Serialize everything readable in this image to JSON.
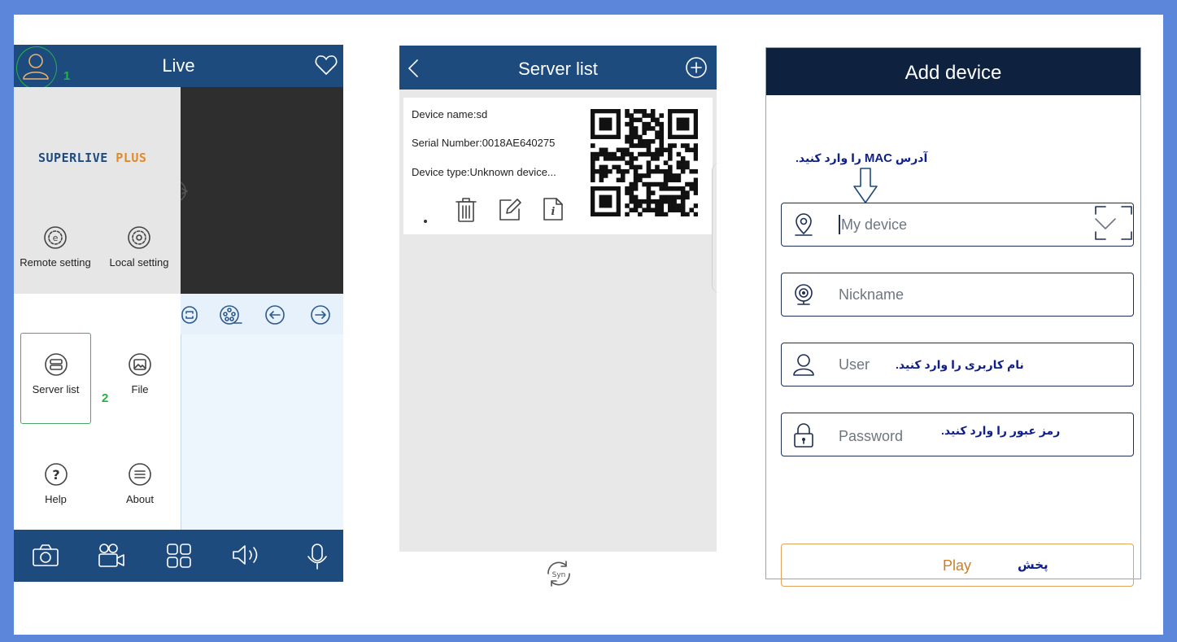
{
  "colors": {
    "frame": "#5b86d9",
    "app_blue": "#1d4b7e",
    "dark_navy": "#0e2240",
    "annotation_green": "#23b33f",
    "annotation_blue": "#0f1f8a",
    "play_orange": "#e3a35a"
  },
  "phone1": {
    "header": {
      "title": "Live",
      "avatar_icon": "user-icon",
      "favorite_icon": "heart-icon"
    },
    "annotations": {
      "step1": "1",
      "step2": "2"
    },
    "logo": {
      "part1": "SUPERLIVE",
      "part2": " PLUS"
    },
    "menu": [
      {
        "label": "Remote setting",
        "icon": "remote-setting-icon"
      },
      {
        "label": "Local setting",
        "icon": "local-setting-icon"
      },
      {
        "label": "Server list",
        "icon": "server-list-icon"
      },
      {
        "label": "File",
        "icon": "file-image-icon"
      },
      {
        "label": "Help",
        "icon": "help-icon"
      },
      {
        "label": "About",
        "icon": "about-icon"
      }
    ],
    "controls": [
      "fullscreen-icon",
      "film-reel-icon",
      "arrow-left-icon",
      "arrow-right-icon"
    ],
    "footer": [
      "camera-icon",
      "video-record-icon",
      "grid-icon",
      "speaker-icon",
      "microphone-icon"
    ]
  },
  "phone2": {
    "header": {
      "title": "Server list",
      "back_icon": "chevron-left-icon",
      "add_icon": "plus-circle-icon"
    },
    "device": {
      "name": "Device name:sd",
      "serial": "Serial Number:0018AE640275",
      "type": "Device type:Unknown device..."
    },
    "actions": [
      "trash-icon",
      "edit-icon",
      "info-icon"
    ],
    "sync_label": "Syn"
  },
  "phone3": {
    "header": {
      "title": "Add device"
    },
    "hint_mac": {
      "before": "آدرس",
      "mac": "MAC",
      "after": "را وارد کنید."
    },
    "fields": {
      "device": {
        "placeholder": "My device",
        "icon": "location-pin-icon"
      },
      "nickname": {
        "placeholder": "Nickname",
        "icon": "webcam-icon"
      },
      "user": {
        "placeholder": "User",
        "icon": "user-icon",
        "note": "نام کاربری را وارد کنید."
      },
      "password": {
        "placeholder": "Password",
        "icon": "lock-icon",
        "note": "رمز عبور را وارد کنید."
      }
    },
    "play": {
      "label": "Play",
      "note": "پخش"
    }
  }
}
